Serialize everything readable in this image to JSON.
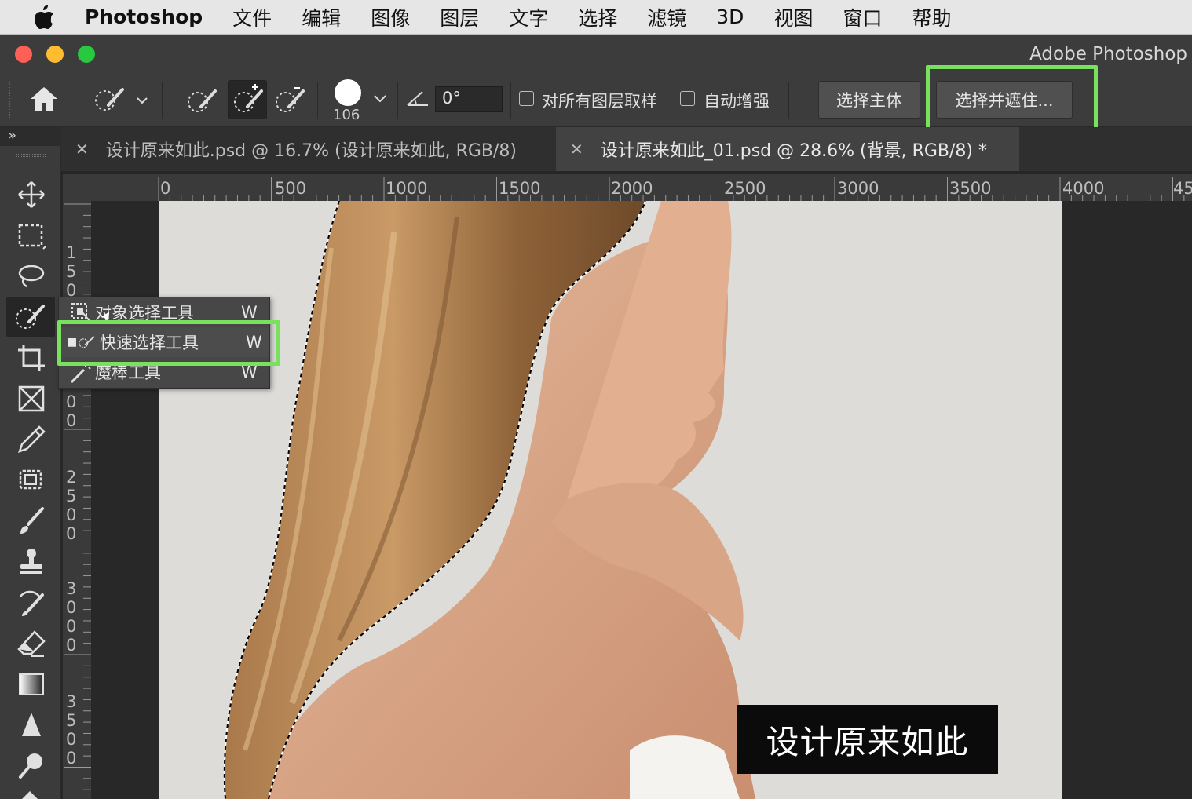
{
  "menubar": {
    "app_name": "Photoshop",
    "items": [
      "文件",
      "编辑",
      "图像",
      "图层",
      "文字",
      "选择",
      "滤镜",
      "3D",
      "视图",
      "窗口",
      "帮助"
    ]
  },
  "window": {
    "title": "Adobe Photoshop"
  },
  "options_bar": {
    "brush_size": "106",
    "angle_value": "0°",
    "sample_all_layers_label": "对所有图层取样",
    "sample_all_layers_checked": false,
    "auto_enhance_label": "自动增强",
    "auto_enhance_checked": false,
    "select_subject_label": "选择主体",
    "select_and_mask_label": "选择并遮住..."
  },
  "panel_collapse_glyph": "»",
  "tabs": [
    {
      "title": "设计原来如此.psd @ 16.7% (设计原来如此, RGB/8)",
      "active": false
    },
    {
      "title": "设计原来如此_01.psd @ 28.6% (背景, RGB/8) *",
      "active": true
    }
  ],
  "ruler": {
    "horizontal": [
      "0",
      "500",
      "1000",
      "1500",
      "2000",
      "2500",
      "3000",
      "3500",
      "4000",
      "45"
    ],
    "vertical": [
      {
        "digits": [
          "1",
          "5",
          "0"
        ]
      },
      {
        "digits": [
          "0",
          "0"
        ]
      },
      {
        "digits": [
          "2",
          "5",
          "0",
          "0"
        ]
      },
      {
        "digits": [
          "3",
          "0",
          "0",
          "0"
        ]
      },
      {
        "digits": [
          "3",
          "5",
          "0",
          "0"
        ]
      }
    ]
  },
  "tool_flyout": {
    "items": [
      {
        "label": "对象选择工具",
        "shortcut": "W",
        "selected": false
      },
      {
        "label": "快速选择工具",
        "shortcut": "W",
        "selected": true
      },
      {
        "label": "魔棒工具",
        "shortcut": "W",
        "selected": false
      }
    ]
  },
  "toolbar_icons": [
    "move-icon",
    "marquee-icon",
    "lasso-icon",
    "quick-selection-icon",
    "crop-icon",
    "frame-icon",
    "eyedropper-icon",
    "patch-icon",
    "brush-icon",
    "stamp-icon",
    "history-brush-icon",
    "eraser-icon",
    "gradient-icon",
    "sharpen-icon",
    "dodge-icon"
  ],
  "canvas": {
    "caption": "设计原来如此"
  },
  "colors": {
    "highlight": "#78e15e",
    "panel": "#3c3c3c",
    "canvas_bg": "#dedcd9"
  }
}
